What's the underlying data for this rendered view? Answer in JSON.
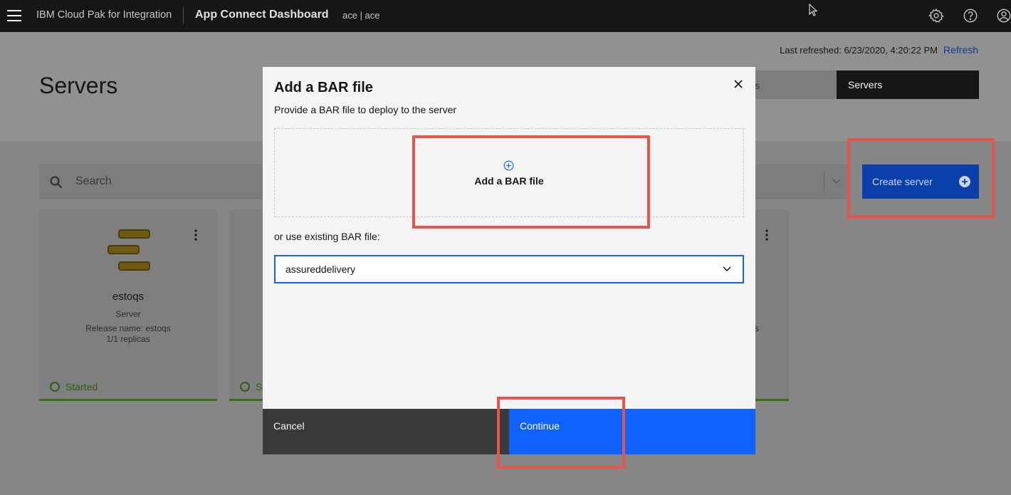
{
  "header": {
    "brand": "IBM Cloud Pak for Integration",
    "app_title": "App Connect Dashboard",
    "namespace": "ace | ace",
    "icons": [
      "settings-icon",
      "help-icon",
      "user-icon"
    ]
  },
  "page": {
    "last_refreshed": "Last refreshed: 6/23/2020, 4:20:22 PM",
    "refresh_label": "Refresh",
    "title": "Servers",
    "tabs": [
      {
        "label": "s",
        "active": false
      },
      {
        "label": "Servers",
        "active": true
      }
    ],
    "search_placeholder": "Search",
    "create_button": "Create server",
    "cards": [
      {
        "name": "estoqs",
        "type": "Server",
        "release": "Release name: estoqs",
        "replicas": "1/1 replicas",
        "status": "Started"
      },
      {
        "status_partial": "St"
      },
      {
        "release_partial": "s"
      }
    ]
  },
  "modal": {
    "title": "Add a BAR file",
    "subtitle": "Provide a BAR file to deploy to the server",
    "dropzone_label": "Add a BAR file",
    "existing_label": "or use existing BAR file:",
    "selected_bar": "assureddelivery",
    "cancel_label": "Cancel",
    "continue_label": "Continue"
  },
  "colors": {
    "primary": "#0f62fe",
    "header_bg": "#161616",
    "highlight": "#e5554b",
    "status_green": "#24a148"
  }
}
